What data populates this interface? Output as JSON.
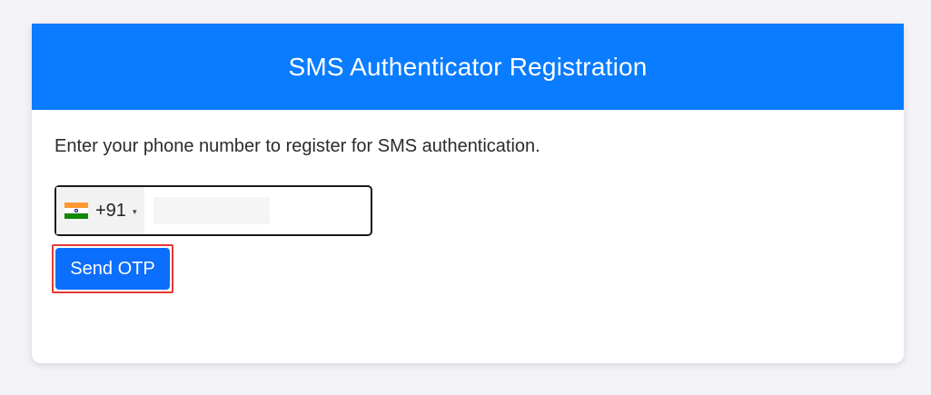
{
  "header": {
    "title": "SMS Authenticator Registration"
  },
  "body": {
    "instruction": "Enter your phone number to register for SMS authentication."
  },
  "phone": {
    "country_flag_icon": "india-flag-icon",
    "dial_code": "+91",
    "dropdown_caret": "▾",
    "value": "",
    "placeholder": ""
  },
  "actions": {
    "send_label": "Send OTP"
  },
  "colors": {
    "header_bg": "#0a7cff",
    "button_bg": "#0b6efd",
    "highlight_border": "#e53935",
    "page_bg": "#f3f3f7"
  }
}
